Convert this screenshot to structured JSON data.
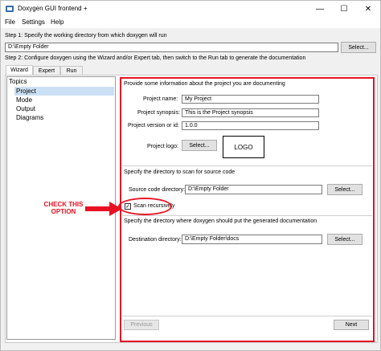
{
  "window": {
    "title": "Doxygen GUI frontend +",
    "controls": {
      "minimize": "—",
      "maximize": "☐",
      "close": "✕"
    }
  },
  "menu": {
    "items": [
      "File",
      "Settings",
      "Help"
    ]
  },
  "step1": {
    "label": "Step 1: Specify the working directory from which doxygen will run",
    "path": "D:\\Empty Folder",
    "select_label": "Select..."
  },
  "step2": {
    "label": "Step 2: Configure doxygen using the Wizard and/or Expert tab, then switch to the Run tab to generate the documentation"
  },
  "tabs": [
    "Wizard",
    "Expert",
    "Run"
  ],
  "topics": {
    "title": "Topics",
    "items": [
      "Project",
      "Mode",
      "Output",
      "Diagrams"
    ],
    "selected": "Project"
  },
  "project": {
    "intro": "Provide some information about the project you are documenting",
    "name_label": "Project name:",
    "name_value": "My Project",
    "synopsis_label": "Project synopsis:",
    "synopsis_value": "This is the Project synopsis",
    "version_label": "Project version or id:",
    "version_value": "1.0.0",
    "logo_label": "Project logo:",
    "logo_select": "Select...",
    "logo_text": "LOGO"
  },
  "source": {
    "intro": "Specify the directory to scan for source code",
    "dir_label": "Source code directory:",
    "dir_value": "D:\\Empty Folder",
    "select_label": "Select...",
    "recursive_label": "Scan recursively",
    "recursive_checked": "✓"
  },
  "dest": {
    "intro": "Specify the directory where doxygen should put the generated documentation",
    "dir_label": "Destination directory:",
    "dir_value": "D:\\Empty Folder\\docs",
    "select_label": "Select..."
  },
  "nav": {
    "previous": "Previous",
    "next": "Next"
  },
  "annotation": {
    "line1": "CHECK THIS",
    "line2": "OPTION"
  },
  "colors": {
    "highlight": "#e81123",
    "selected_topic": "#cce0f5"
  }
}
